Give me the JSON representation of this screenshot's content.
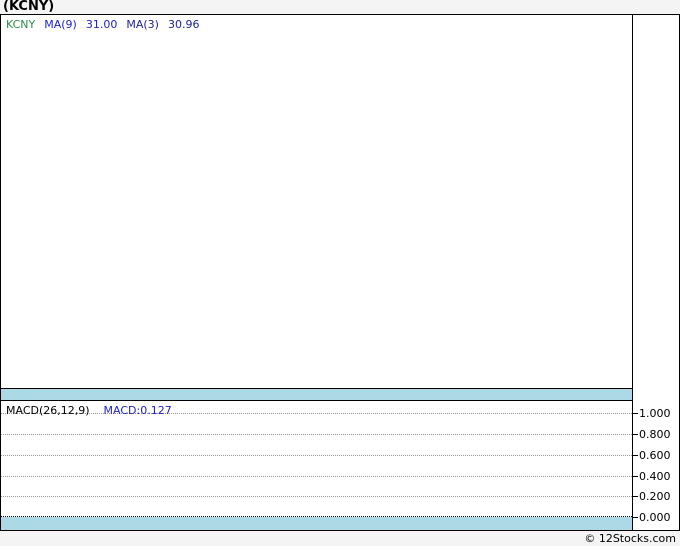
{
  "page": {
    "title": "(KCNY)",
    "footer": "© 12Stocks.com"
  },
  "price_panel": {
    "legend": {
      "symbol": "KCNY",
      "ma9_label": "MA(9)",
      "ma9_value": "31.00",
      "ma3_label": "MA(3)",
      "ma3_value": "30.96"
    }
  },
  "macd_panel": {
    "legend_label": "MACD(26,12,9)",
    "legend_value": "MACD:0.127",
    "yticks": [
      "1.000",
      "0.800",
      "0.600",
      "0.400",
      "0.200",
      "0.000"
    ]
  },
  "colors": {
    "separator_band": "#ADD8E6",
    "symbol_green": "#2E8B50",
    "legend_blue": "#2222CC",
    "legend_navy": "#222299",
    "grid_gray": "#999999",
    "page_bg": "#F4F4F4"
  },
  "chart_data": [
    {
      "type": "line",
      "panel": "price",
      "title": "(KCNY)",
      "series": [
        {
          "name": "KCNY",
          "values": []
        },
        {
          "name": "MA(9)",
          "last_value": 31.0,
          "values": []
        },
        {
          "name": "MA(3)",
          "last_value": 30.96,
          "values": []
        }
      ],
      "note": "panel rendered empty - no visible price data points",
      "grid": false,
      "legend_position": "top-left"
    },
    {
      "type": "line",
      "panel": "MACD(26,12,9)",
      "series": [
        {
          "name": "MACD",
          "last_value": 0.127,
          "values": []
        }
      ],
      "yticks": [
        1.0,
        0.8,
        0.6,
        0.4,
        0.2,
        0.0
      ],
      "ylim": [
        -0.06,
        1.06
      ],
      "grid": true,
      "note": "panel rendered empty - no visible MACD line, dotted gridlines only, zero line emphasized",
      "legend_position": "top-left"
    }
  ]
}
